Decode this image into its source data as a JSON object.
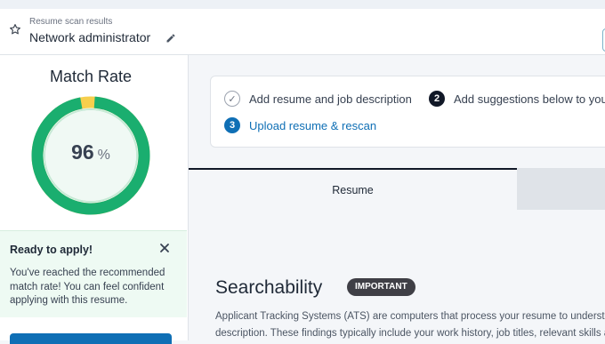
{
  "header": {
    "breadcrumb": "Resume scan results",
    "title": "Network administrator",
    "star_icon": "star-icon",
    "edit_icon": "pencil-icon"
  },
  "sidebar": {
    "match_title": "Match Rate",
    "match_value": "96",
    "match_unit": "%",
    "match_rate": 0.96,
    "gauge_color": "#1aae6f",
    "ready": {
      "title": "Ready to apply!",
      "text": "You've reached the recommended match rate! You can feel confident applying with this resume.",
      "close_icon": "close-icon"
    }
  },
  "steps": [
    {
      "marker": "✓",
      "label": "Add resume and job description",
      "state": "done"
    },
    {
      "marker": "2",
      "label": "Add suggestions below to your",
      "state": "current"
    },
    {
      "marker": "3",
      "label": "Upload resume & rescan",
      "state": "link"
    }
  ],
  "tabs": {
    "active": "Resume"
  },
  "section": {
    "title": "Searchability",
    "badge": "IMPORTANT",
    "description_line1": "Applicant Tracking Systems (ATS) are computers that process your resume to understand",
    "description_line2": "description. These findings typically include your work history, job titles, relevant skills and"
  },
  "colors": {
    "accent": "#0f6fb5",
    "success": "#1aae6f",
    "success_bg": "#eefaf3"
  }
}
